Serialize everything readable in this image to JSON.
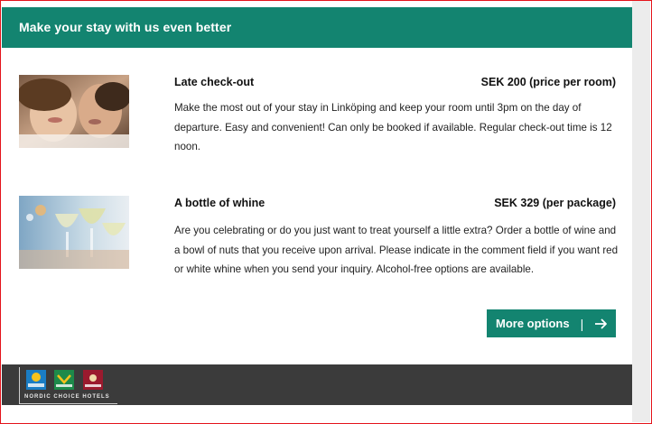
{
  "header": {
    "title": "Make your stay with us even better"
  },
  "items": [
    {
      "title": "Late check-out",
      "price": "SEK 200 (price per room)",
      "description": "Make the most out of your stay in Linköping and keep your room until 3pm on the day of departure. Easy and convenient! Can only be booked if available. Regular check-out time is 12 noon."
    },
    {
      "title": "A bottle of whine",
      "price": "SEK 329 (per package)",
      "description": "Are you celebrating or do you just want to treat yourself a little extra? Order a bottle of wine and a bowl of nuts that you receive upon arrival. Please indicate in the comment field if you want red or white whine when you send your inquiry. Alcohol-free options are available."
    }
  ],
  "button": {
    "label": "More options",
    "separator": "|",
    "icon": "arrow-right-icon"
  },
  "footer": {
    "logo_text": "NORDIC CHOICE HOTELS",
    "brands": [
      {
        "name": "Comfort",
        "color": "#1a7dc4"
      },
      {
        "name": "Quality",
        "color": "#1d8a4a"
      },
      {
        "name": "Clarion",
        "color": "#9b1a2e"
      }
    ]
  },
  "colors": {
    "accent": "#138470",
    "footer": "#3b3b3b",
    "frame": "#e4141b"
  }
}
